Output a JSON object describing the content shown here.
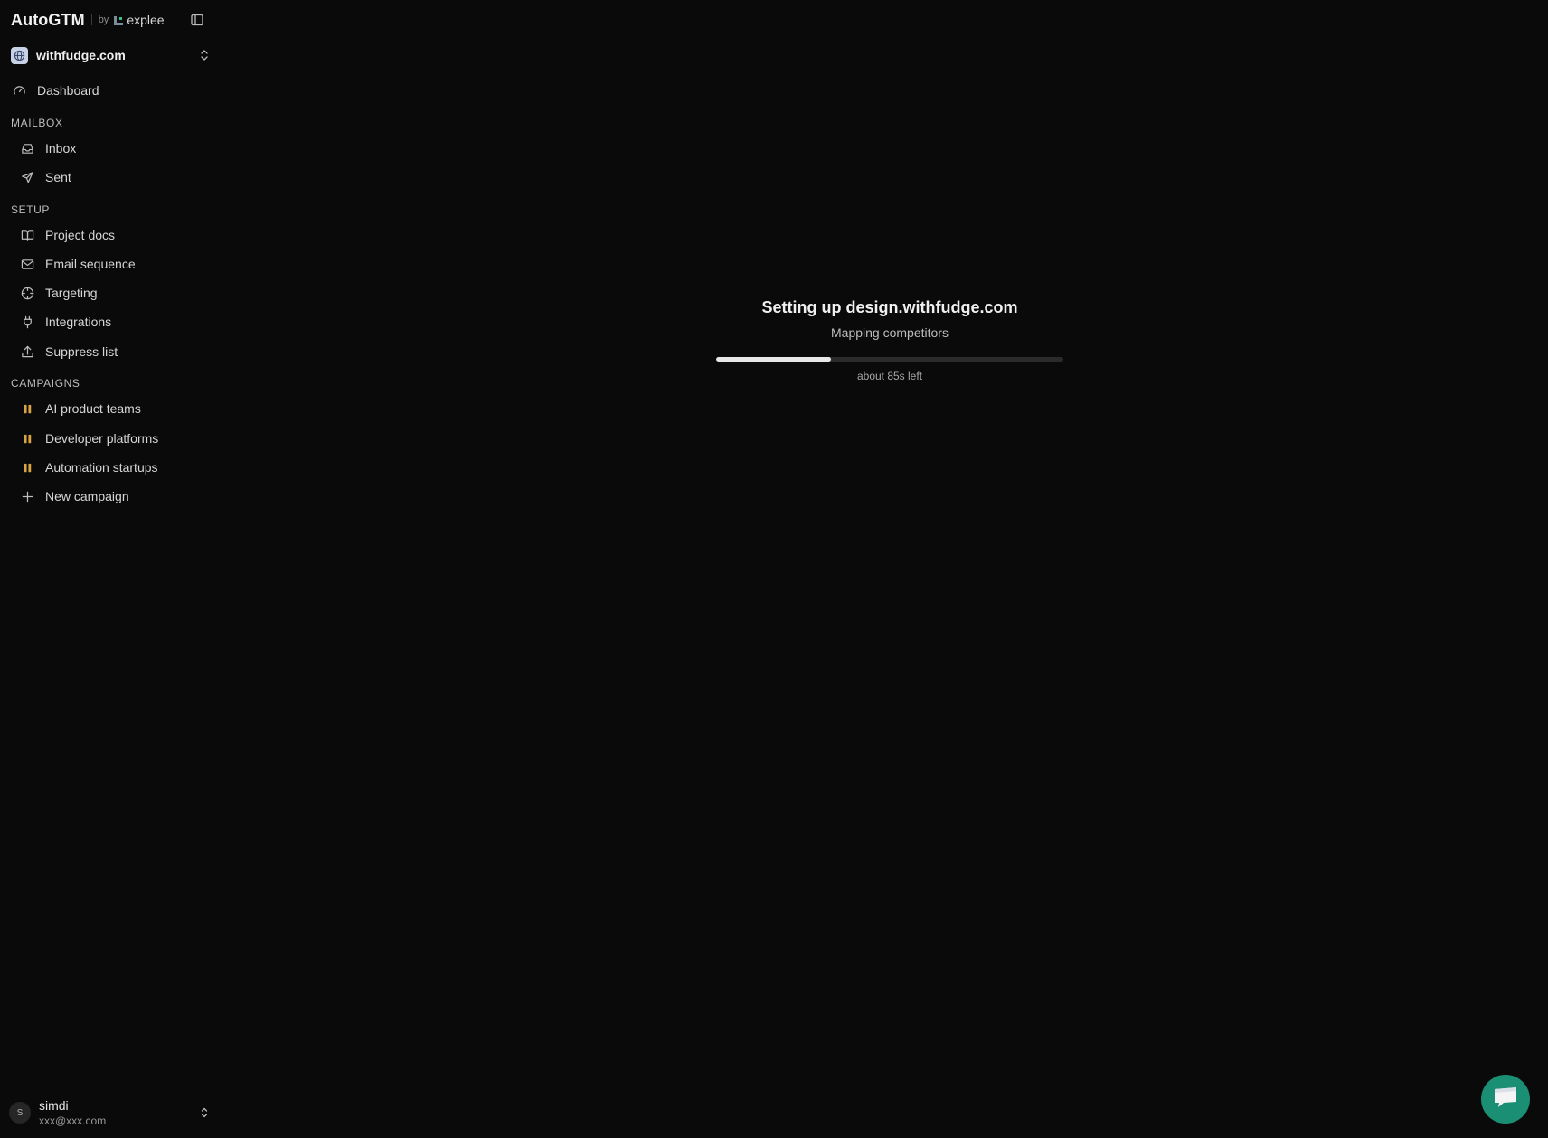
{
  "brand": {
    "title": "AutoGTM",
    "by": "by",
    "partner": "explee"
  },
  "workspace": {
    "name": "withfudge.com"
  },
  "nav": {
    "dashboard": "Dashboard",
    "mailbox_label": "MAILBOX",
    "inbox": "Inbox",
    "sent": "Sent",
    "setup_label": "SETUP",
    "project_docs": "Project docs",
    "email_sequence": "Email sequence",
    "targeting": "Targeting",
    "integrations": "Integrations",
    "suppress_list": "Suppress list",
    "campaigns_label": "CAMPAIGNS",
    "campaigns": [
      {
        "label": "AI product teams"
      },
      {
        "label": "Developer platforms"
      },
      {
        "label": "Automation startups"
      }
    ],
    "new_campaign": "New campaign"
  },
  "user": {
    "initial": "S",
    "name": "simdi",
    "email": "xxx@xxx.com"
  },
  "setup": {
    "title": "Setting up design.withfudge.com",
    "step": "Mapping competitors",
    "progress_percent": 33,
    "eta": "about 85s left"
  },
  "colors": {
    "background": "#0a0a0a",
    "campaign_paused": "#d9a441",
    "chat_button": "#1b8f74",
    "progress_fill": "#e8e8e8"
  },
  "icons": {
    "collapse": "sidebar-collapse-icon",
    "workspace": "globe-icon",
    "dashboard": "gauge-icon",
    "inbox": "inbox-icon",
    "sent": "send-icon",
    "project_docs": "book-open-icon",
    "email_sequence": "mail-icon",
    "targeting": "crosshair-icon",
    "integrations": "plug-icon",
    "suppress_list": "upload-icon",
    "campaign": "pause-icon",
    "new_campaign": "plus-icon",
    "chat": "chat-icon"
  }
}
